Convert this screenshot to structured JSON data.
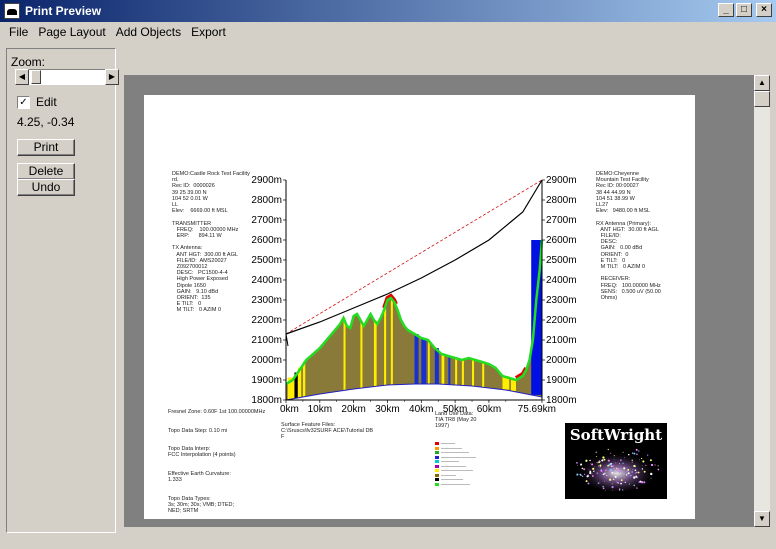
{
  "window": {
    "title": "Print Preview"
  },
  "menu": [
    "File",
    "Page Layout",
    "Add Objects",
    "Export"
  ],
  "panel": {
    "zoom_label": "Zoom:",
    "edit_label": "Edit",
    "edit_checked": "✓",
    "coords": "4.25, -0.34",
    "print_label": "Print",
    "delete_label": "Delete",
    "undo_label": "Undo"
  },
  "report": {
    "left_header": "DEMO:Castle Rock Test Facility\nrd.\nRec ID:  0000026\n39 25 39.00 N\n104 52 0.01 W\nLL\nElev:    6669.00 ft MSL\n\nTRANSMITTER\n   FREQ:    100.00000 MHz\n   ERP:      894.11 W\n\nTX Antenna:\n   ANT HGT:  300.00 ft AGL\n   FILE/ID:  AMS20027\n   Z092700012\n   DESC:   PC1500-4-4\n   High Power Exposed\n   Dipole 1650\n   GAIN:   9.10 dBd\n   ORIENT:  135\n   E TILT:   0\n   M TILT:   0 AZIM 0",
    "right_header": "DEMO:Cheyenne\nMountain Test Facility\nRec ID: 00:00027\n38 44 44.99 N\n104 51 38.99 W\nLL27\nElev:   9480.00 ft MSL\n\nRX Antenna (Primary):\n   ANT HGT:  30.00 ft AGL\n   FILE/ID:\n   DESC:\n   GAIN:   0.00 dBd\n   ORIENT:  0\n   E TILT:   0\n   M TILT:   0 AZIM 0\n\n   RECEIVER:\n   FREQ:   100.00000 MHz\n   SENS:   0.500 uV (50.00\n   Ohms)",
    "bottom_left": "Fresnel Zone: 0.60F 1st 100.00000MHz\n\n\nTopo Data Step: 0.10 mi\n\n\nTopo Data Interp:\nFCC Interpolation (4 points)\n\n\nEffective Earth Curvature:\n1.333\n\n\nTopo Data Types:\n3s; 30m; 30s; VMB; DTED;\nNED; SRTM",
    "bottom_mid": "Surface Feature Files:\nC:\\Sruscs\\fv32SURF ACE\\Tutorial DB\nF",
    "land_use_title": "Land Use Data:\nTIA TR8 (May 20\n1997)",
    "logo_text": "SoftWright"
  },
  "chart_data": {
    "type": "area",
    "xlabel": "",
    "ylabel": "",
    "x_ticks": [
      "0km",
      "10km",
      "20km",
      "30km",
      "40km",
      "50km",
      "60km",
      "75.69km"
    ],
    "y_ticks_left": [
      "1800m",
      "1900m",
      "2000m",
      "2100m",
      "2200m",
      "2300m",
      "2400m",
      "2500m",
      "2600m",
      "2700m",
      "2800m",
      "2900m"
    ],
    "y_ticks_right": [
      "1800m",
      "1900m",
      "2000m",
      "2100m",
      "2200m",
      "2300m",
      "2400m",
      "2500m",
      "2600m",
      "2700m",
      "2800m",
      "2900m"
    ],
    "xlim": [
      0,
      75.69
    ],
    "ylim": [
      1800,
      2900
    ],
    "series": [
      {
        "values": [
          [
            0,
            1880
          ],
          [
            2,
            1900
          ],
          [
            4,
            1950
          ],
          [
            6,
            2000
          ],
          [
            8,
            2030
          ],
          [
            10,
            2060
          ],
          [
            12,
            2100
          ],
          [
            14,
            2140
          ],
          [
            16,
            2180
          ],
          [
            17,
            2210
          ],
          [
            18,
            2170
          ],
          [
            19,
            2160
          ],
          [
            20,
            2220
          ],
          [
            21,
            2230
          ],
          [
            22,
            2200
          ],
          [
            23,
            2170
          ],
          [
            24,
            2200
          ],
          [
            25,
            2230
          ],
          [
            26,
            2200
          ],
          [
            27,
            2180
          ],
          [
            28,
            2210
          ],
          [
            29,
            2250
          ],
          [
            30,
            2300
          ],
          [
            31,
            2310
          ],
          [
            32,
            2290
          ],
          [
            33,
            2250
          ],
          [
            34,
            2200
          ],
          [
            35,
            2170
          ],
          [
            36,
            2150
          ],
          [
            38,
            2130
          ],
          [
            40,
            2110
          ],
          [
            42,
            2100
          ],
          [
            44,
            2060
          ],
          [
            46,
            2030
          ],
          [
            48,
            2020
          ],
          [
            50,
            2010
          ],
          [
            52,
            2000
          ],
          [
            54,
            2010
          ],
          [
            56,
            2000
          ],
          [
            58,
            1990
          ],
          [
            60,
            1980
          ],
          [
            62,
            1960
          ],
          [
            64,
            1920
          ],
          [
            66,
            1910
          ],
          [
            68,
            1900
          ],
          [
            70,
            1920
          ],
          [
            71,
            1950
          ],
          [
            72,
            2000
          ],
          [
            73,
            2100
          ],
          [
            74,
            2300
          ],
          [
            75,
            2450
          ],
          [
            75.69,
            2600
          ]
        ]
      },
      {
        "values": [
          [
            0,
            2130
          ],
          [
            75.69,
            2900
          ]
        ]
      },
      {
        "values": [
          [
            0,
            2130
          ],
          [
            10,
            2190
          ],
          [
            20,
            2260
          ],
          [
            30,
            2330
          ],
          [
            40,
            2410
          ],
          [
            50,
            2500
          ],
          [
            60,
            2600
          ],
          [
            70,
            2740
          ],
          [
            75.69,
            2900
          ]
        ]
      }
    ],
    "curve_baseline": [
      [
        0,
        1800
      ],
      [
        10,
        1830
      ],
      [
        20,
        1855
      ],
      [
        30,
        1875
      ],
      [
        38,
        1880
      ],
      [
        45,
        1880
      ],
      [
        55,
        1870
      ],
      [
        65,
        1850
      ],
      [
        75.69,
        1815
      ]
    ],
    "grid": false
  }
}
